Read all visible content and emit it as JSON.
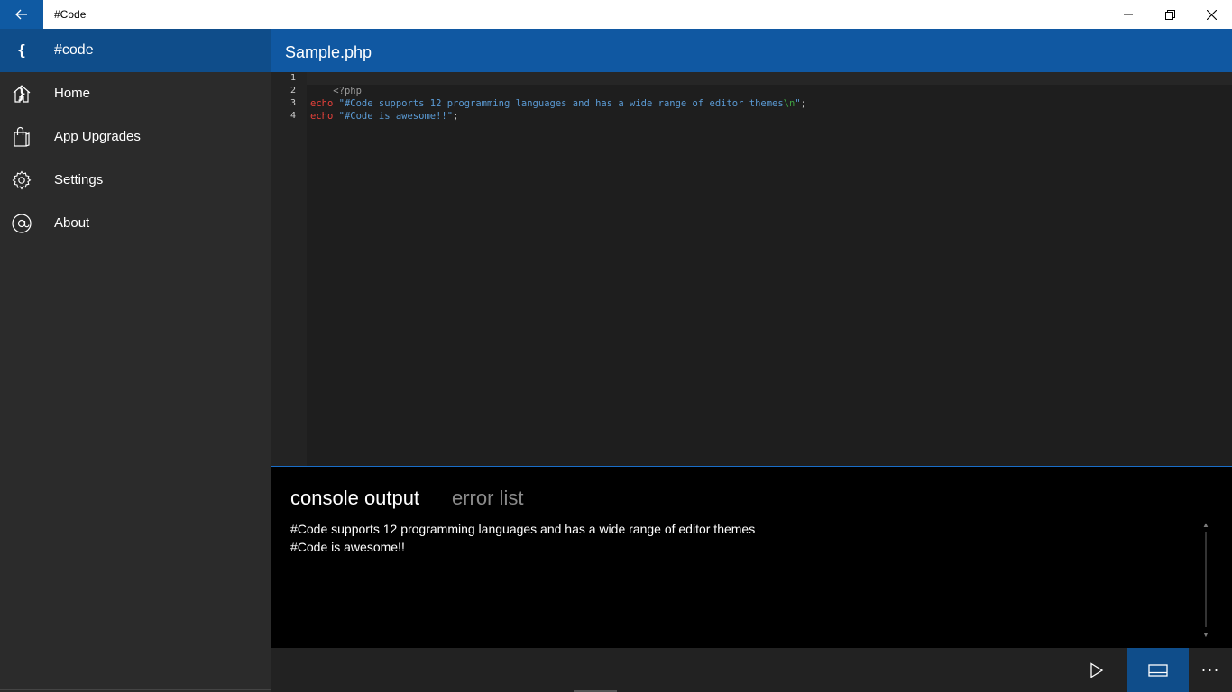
{
  "titlebar": {
    "title": "#Code",
    "back_icon": "back-arrow-icon",
    "minimize_icon": "minimize-icon",
    "maximize_icon": "restore-icon",
    "close_icon": "close-icon"
  },
  "sidebar": {
    "header": {
      "glyph": "{ }",
      "label": "#code"
    },
    "items": [
      {
        "label": "Home",
        "icon": "home-icon"
      },
      {
        "label": "App Upgrades",
        "icon": "shopping-bag-icon"
      },
      {
        "label": "Settings",
        "icon": "gear-icon"
      },
      {
        "label": "About",
        "icon": "at-sign-icon"
      }
    ]
  },
  "editor": {
    "filename": "Sample.php",
    "line_numbers": [
      "1",
      "2",
      "3",
      "4"
    ],
    "lines": {
      "line1": "<?php",
      "line3_kw": "echo",
      "line3_str": "\"#Code supports 12 programming languages and has a wide range of editor themes",
      "line3_esc": "\\n",
      "line3_strend": "\"",
      "line3_end": ";",
      "line4_kw": "echo",
      "line4_str": "\"#Code is awesome!!\"",
      "line4_end": ";"
    }
  },
  "console": {
    "tabs": [
      "console output",
      "error list"
    ],
    "active_tab": "console output",
    "output": [
      "#Code supports 12 programming languages and has a wide range of editor themes",
      "#Code is awesome!!"
    ]
  },
  "commandbar": {
    "run_icon": "play-icon",
    "console_icon": "console-panel-icon",
    "more_label": "···"
  },
  "colors": {
    "accent": "#0f5aa3",
    "sidebar_bg": "#2b2b2b",
    "editor_bg": "#1e1e1e",
    "keyword": "#e8413b",
    "string": "#5b9bd5",
    "escape": "#3fa142"
  }
}
